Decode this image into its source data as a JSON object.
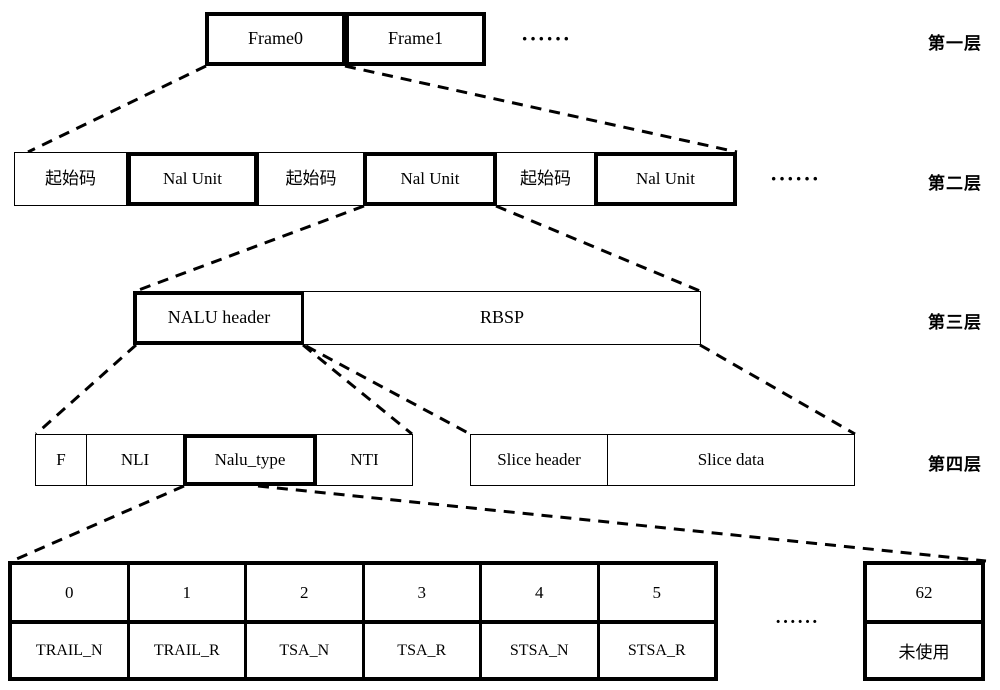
{
  "diagram": {
    "title_layers": [
      "第一层",
      "第二层",
      "第三层",
      "第四层"
    ],
    "ellipsis": "······"
  },
  "layer1": {
    "label": "第一层",
    "boxes": [
      {
        "text": "Frame0"
      },
      {
        "text": "Frame1"
      }
    ],
    "ellipsis": "······"
  },
  "layer2": {
    "label": "第二层",
    "boxes": [
      {
        "text": "起始码",
        "style": "thin"
      },
      {
        "text": "Nal Unit",
        "style": "bold"
      },
      {
        "text": "起始码",
        "style": "thin"
      },
      {
        "text": "Nal Unit",
        "style": "bold"
      },
      {
        "text": "起始码",
        "style": "thin"
      },
      {
        "text": "Nal Unit",
        "style": "bold"
      }
    ],
    "ellipsis": "······"
  },
  "layer3": {
    "label": "第三层",
    "boxes": [
      {
        "text": "NALU header",
        "style": "bold"
      },
      {
        "text": "RBSP",
        "style": "thin"
      }
    ]
  },
  "layer4": {
    "label": "第四层",
    "header_boxes": [
      {
        "text": "F",
        "style": "thin"
      },
      {
        "text": "NLI",
        "style": "thin"
      },
      {
        "text": "Nalu_type",
        "style": "bold"
      },
      {
        "text": "NTI",
        "style": "thin"
      }
    ],
    "rbsp_boxes": [
      {
        "text": "Slice header",
        "style": "thin"
      },
      {
        "text": "Slice data",
        "style": "thin"
      }
    ]
  },
  "nalu_type_table": {
    "ids": [
      "0",
      "1",
      "2",
      "3",
      "4",
      "5"
    ],
    "names": [
      "TRAIL_N",
      "TRAIL_R",
      "TSA_N",
      "TSA_R",
      "STSA_N",
      "STSA_R"
    ],
    "ellipsis": "······",
    "last": {
      "id": "62",
      "name": "未使用"
    }
  }
}
